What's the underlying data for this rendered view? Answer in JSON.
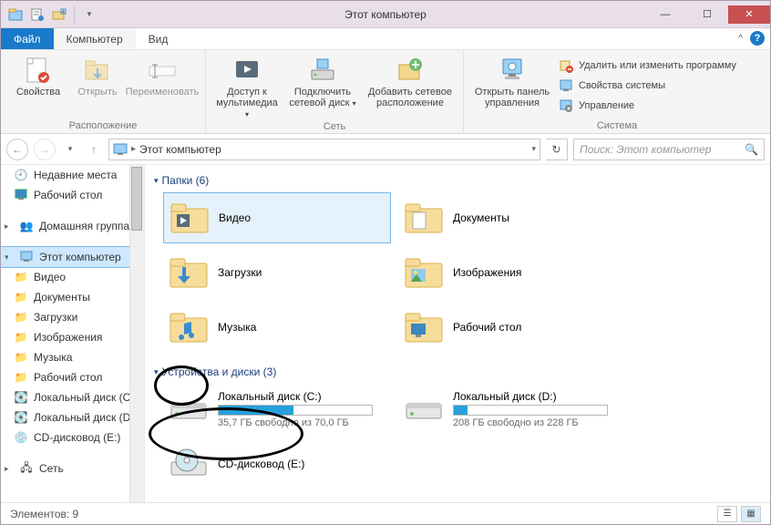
{
  "title": "Этот компьютер",
  "menu": {
    "file": "Файл",
    "computer": "Компьютер",
    "view": "Вид"
  },
  "ribbon": {
    "location": {
      "label": "Расположение",
      "properties": "Свойства",
      "open": "Открыть",
      "rename": "Переименовать"
    },
    "network": {
      "label": "Сеть",
      "media": "Доступ к мультимедиа",
      "mapdrive": "Подключить сетевой диск",
      "addloc": "Добавить сетевое расположение"
    },
    "system": {
      "label": "Система",
      "cpanel": "Открыть панель управления",
      "uninstall": "Удалить или изменить программу",
      "sysprops": "Свойства системы",
      "manage": "Управление"
    }
  },
  "breadcrumb": "Этот компьютер",
  "search_placeholder": "Поиск: Этот компьютер",
  "sidebar": {
    "recent": "Недавние места",
    "desktop": "Рабочий стол",
    "homegroup": "Домашняя группа",
    "thispc": "Этот компьютер",
    "videos": "Видео",
    "documents": "Документы",
    "downloads": "Загрузки",
    "pictures": "Изображения",
    "music": "Музыка",
    "sdesktop": "Рабочий стол",
    "diskc": "Локальный диск (C:)",
    "diskd": "Локальный диск (D:)",
    "cddrive": "CD-дисковод (E:)",
    "network": "Сеть"
  },
  "sections": {
    "folders": "Папки (6)",
    "devices": "Устройства и диски (3)"
  },
  "folders": {
    "videos": "Видео",
    "documents": "Документы",
    "downloads": "Загрузки",
    "pictures": "Изображения",
    "music": "Музыка",
    "desktop": "Рабочий стол"
  },
  "drives": {
    "c": {
      "name": "Локальный диск (C:)",
      "free": "35,7 ГБ свободно из 70,0 ГБ",
      "fill": 49
    },
    "d": {
      "name": "Локальный диск (D:)",
      "free": "208 ГБ свободно из 228 ГБ",
      "fill": 9
    },
    "e": {
      "name": "CD-дисковод (E:)"
    }
  },
  "status": "Элементов: 9"
}
